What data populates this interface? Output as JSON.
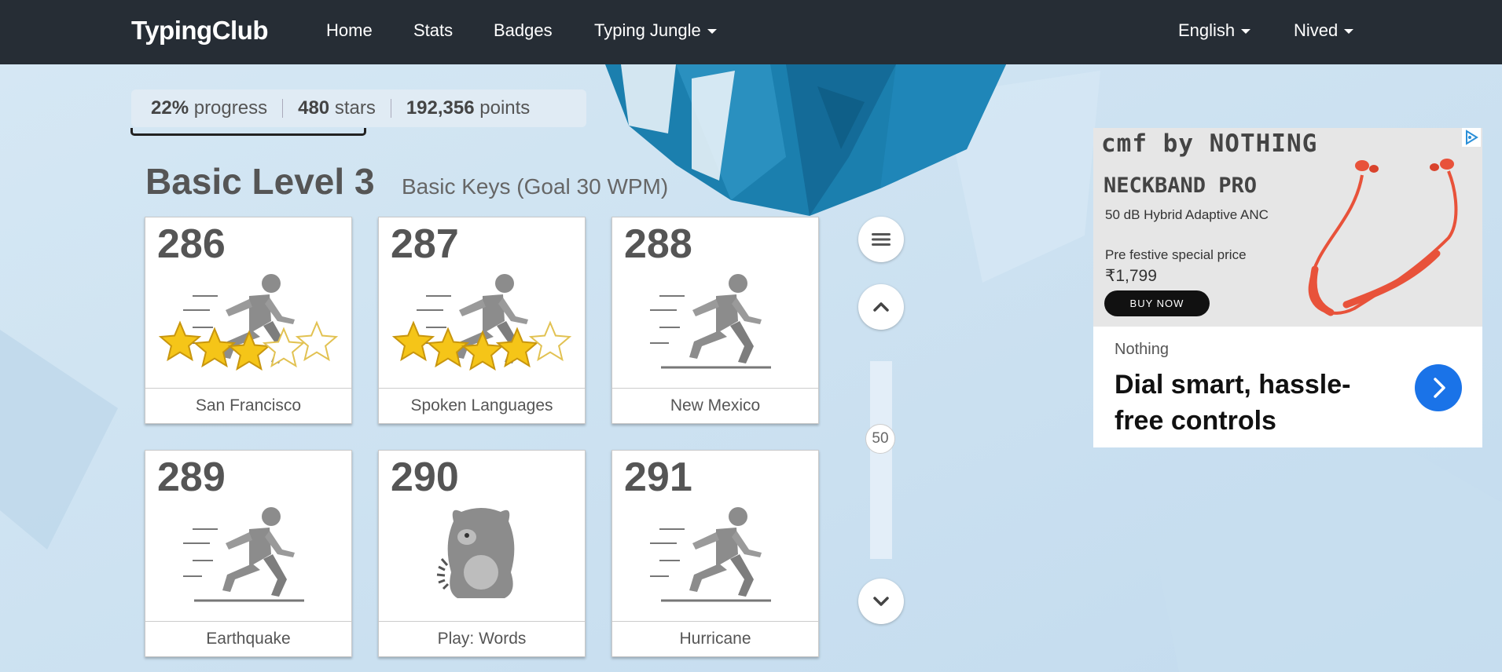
{
  "nav": {
    "brand": "TypingClub",
    "links": [
      "Home",
      "Stats",
      "Badges"
    ],
    "jungle": "Typing Jungle",
    "language": "English",
    "user": "Nived"
  },
  "stats": {
    "progress_value": "22%",
    "progress_label": "progress",
    "stars_value": "480",
    "stars_label": "stars",
    "points_value": "192,356",
    "points_label": "points"
  },
  "level": {
    "title": "Basic Level 3",
    "subtitle": "Basic Keys (Goal 30 WPM)"
  },
  "lessons": [
    {
      "number": "286",
      "name": "San Francisco",
      "icon": "runner-icon",
      "stars": 3
    },
    {
      "number": "287",
      "name": "Spoken Languages",
      "icon": "runner-icon",
      "stars": 4
    },
    {
      "number": "288",
      "name": "New Mexico",
      "icon": "runner-icon",
      "stars": 0
    },
    {
      "number": "289",
      "name": "Earthquake",
      "icon": "runner-icon",
      "stars": 0
    },
    {
      "number": "290",
      "name": "Play: Words",
      "icon": "monster-icon",
      "stars": 0
    },
    {
      "number": "291",
      "name": "Hurricane",
      "icon": "runner-icon",
      "stars": 0
    }
  ],
  "scroller": {
    "value": "50"
  },
  "ad": {
    "brand": "cmf by NOTHING",
    "product": "NECKBAND PRO",
    "feature": "50 dB Hybrid Adaptive ANC",
    "promo": "Pre festive special price",
    "price": "₹1,799",
    "buy_label": "BUY NOW",
    "advertiser": "Nothing",
    "headline": "Dial smart, hassle-free controls"
  },
  "colors": {
    "nav_bg": "#262d35",
    "star_fill": "#f5c518",
    "cta_blue": "#1a73e8"
  }
}
